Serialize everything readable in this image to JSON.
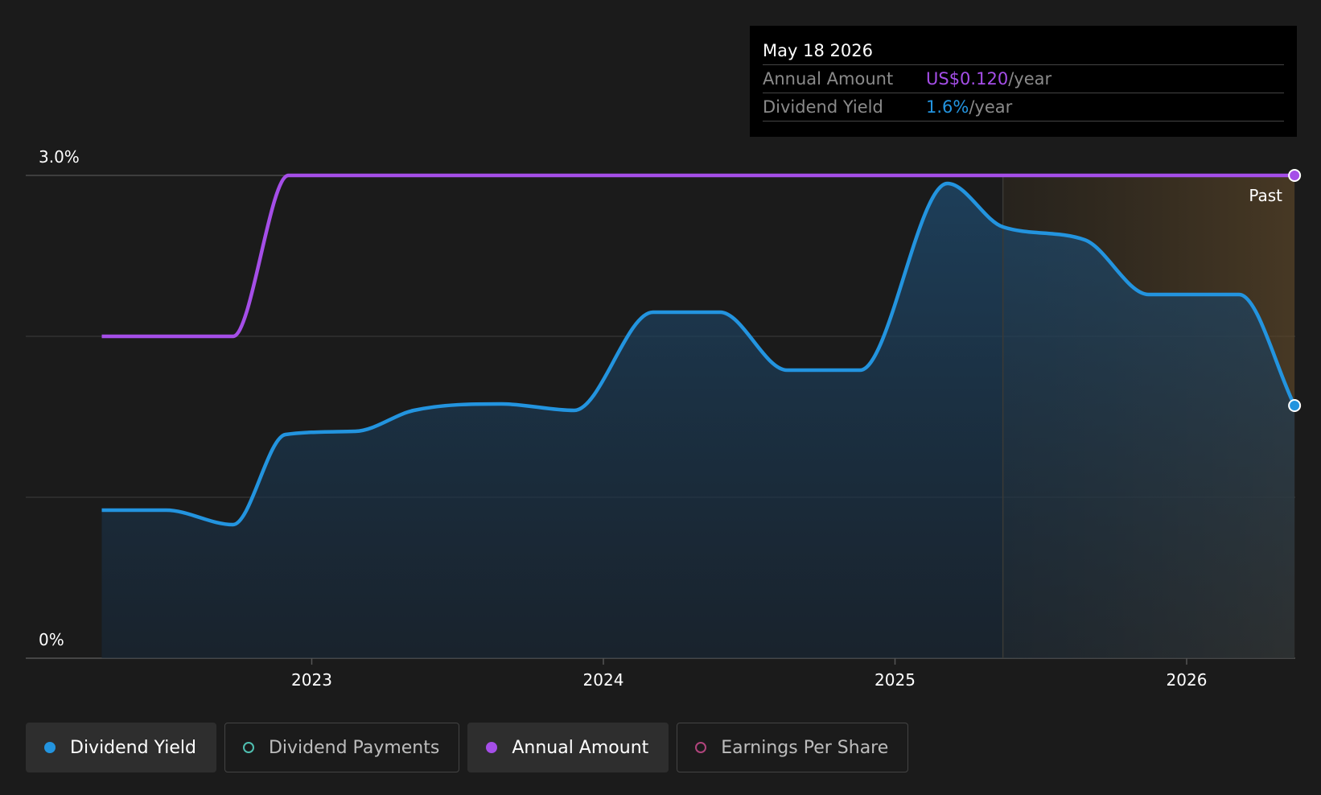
{
  "chart_data": {
    "type": "line",
    "x_axis": {
      "ticks": [
        "2023",
        "2024",
        "2025",
        "2026"
      ]
    },
    "y_axis": {
      "ticks": [
        "0%",
        "3.0%"
      ],
      "ylim": [
        0,
        3.0
      ]
    },
    "grid": true,
    "past_region_label": "Past",
    "series": [
      {
        "name": "Dividend Yield",
        "color": "#2394df",
        "points": [
          {
            "x": 2022.28,
            "y": 0.92
          },
          {
            "x": 2022.5,
            "y": 0.92
          },
          {
            "x": 2022.73,
            "y": 0.83
          },
          {
            "x": 2022.91,
            "y": 1.39
          },
          {
            "x": 2023.15,
            "y": 1.41
          },
          {
            "x": 2023.35,
            "y": 1.54
          },
          {
            "x": 2023.65,
            "y": 1.58
          },
          {
            "x": 2023.9,
            "y": 1.54
          },
          {
            "x": 2024.17,
            "y": 2.15
          },
          {
            "x": 2024.4,
            "y": 2.15
          },
          {
            "x": 2024.63,
            "y": 1.79
          },
          {
            "x": 2024.88,
            "y": 1.79
          },
          {
            "x": 2025.18,
            "y": 2.95
          },
          {
            "x": 2025.37,
            "y": 2.68
          },
          {
            "x": 2025.65,
            "y": 2.6
          },
          {
            "x": 2025.87,
            "y": 2.26
          },
          {
            "x": 2026.18,
            "y": 2.26
          },
          {
            "x": 2026.37,
            "y": 1.57
          }
        ]
      },
      {
        "name": "Annual Amount",
        "color": "#a54ee8",
        "points": [
          {
            "x": 2022.28,
            "y": 2.0
          },
          {
            "x": 2022.73,
            "y": 2.0
          },
          {
            "x": 2022.92,
            "y": 3.0
          },
          {
            "x": 2026.37,
            "y": 3.0
          }
        ]
      }
    ]
  },
  "tooltip": {
    "date": "May 18 2026",
    "rows": [
      {
        "label": "Annual Amount",
        "value": "US$0.120",
        "unit": "/year",
        "color": "#a54ee8"
      },
      {
        "label": "Dividend Yield",
        "value": "1.6%",
        "unit": "/year",
        "color": "#2394df"
      }
    ]
  },
  "legend": [
    {
      "label": "Dividend Yield",
      "color": "#2394df",
      "style": "filled",
      "active": true
    },
    {
      "label": "Dividend Payments",
      "color": "#4fbfb0",
      "style": "hollow",
      "active": false
    },
    {
      "label": "Annual Amount",
      "color": "#a54ee8",
      "style": "filled",
      "active": true
    },
    {
      "label": "Earnings Per Share",
      "color": "#b0447c",
      "style": "hollow",
      "active": false
    }
  ]
}
